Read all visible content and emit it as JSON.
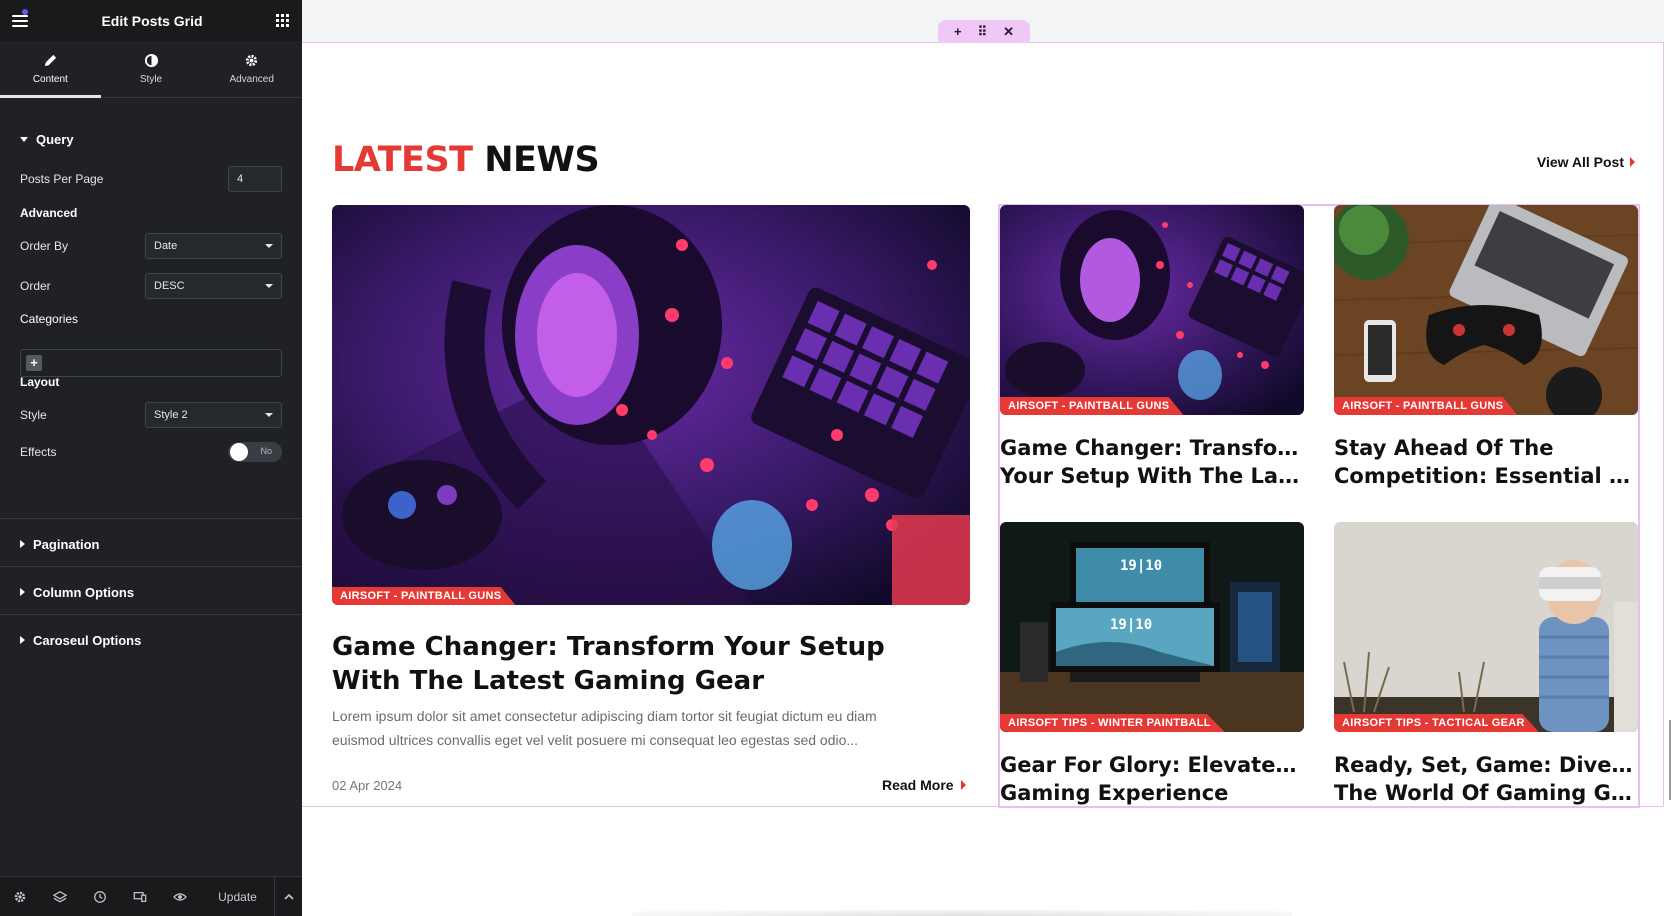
{
  "sidebar": {
    "title": "Edit Posts Grid",
    "tabs": [
      {
        "label": "Content",
        "icon": "pencil-icon"
      },
      {
        "label": "Style",
        "icon": "half-circle-icon"
      },
      {
        "label": "Advanced",
        "icon": "gear-icon"
      }
    ],
    "query": {
      "label": "Query",
      "posts_per_page_label": "Posts Per Page",
      "posts_per_page_value": "4",
      "advanced_label": "Advanced",
      "order_by_label": "Order By",
      "order_by_value": "Date",
      "order_label": "Order",
      "order_value": "DESC",
      "categories_label": "Categories",
      "categories_add": "+",
      "layout_label": "Layout",
      "style_label": "Style",
      "style_value": "Style 2",
      "effects_label": "Effects",
      "effects_value": "No"
    },
    "sections": [
      "Pagination",
      "Column Options",
      "Caroseul Options"
    ],
    "footer": {
      "update_label": "Update",
      "icons": [
        "settings-icon",
        "layers-icon",
        "history-icon",
        "responsive-icon",
        "preview-icon"
      ]
    }
  },
  "canvas": {
    "heading_red": "LATEST",
    "heading_black": "NEWS",
    "view_all": "View All Post",
    "featured": {
      "category": "AIRSOFT  -  PAINTBALL GUNS",
      "title": "Game Changer: Transform Your Setup With The Latest Gaming Gear",
      "excerpt": "Lorem ipsum dolor sit amet consectetur adipiscing diam tortor sit feugiat dictum eu diam euismod ultrices convallis eget vel velit posuere mi consequat leo egestas sed odio...",
      "date": "02 Apr 2024",
      "read_more": "Read More"
    },
    "posts": [
      {
        "category": "AIRSOFT  -  PAINTBALL GUNS",
        "title_line1": "Game Changer: Transform",
        "title_line2": "Your Setup With The Latest..."
      },
      {
        "category": "AIRSOFT  -  PAINTBALL GUNS",
        "title_line1": "Stay Ahead Of The",
        "title_line2": "Competition: Essential Gami..."
      },
      {
        "category": "AIRSOFT TIPS  -  WINTER PAINTBALL",
        "title_line1": "Gear For Glory: Elevate Your",
        "title_line2": "Gaming Experience"
      },
      {
        "category": "AIRSOFT TIPS  -  TACTICAL GEAR",
        "title_line1": "Ready, Set, Game: Dive Into",
        "title_line2": "The World Of Gaming Gear"
      }
    ],
    "section_handle_icons": [
      "plus-icon",
      "drag-handle-icon",
      "close-icon"
    ],
    "colors": {
      "accent": "#e53935",
      "editor_outline": "#e8c0ef",
      "panel_bg": "#202124"
    }
  }
}
